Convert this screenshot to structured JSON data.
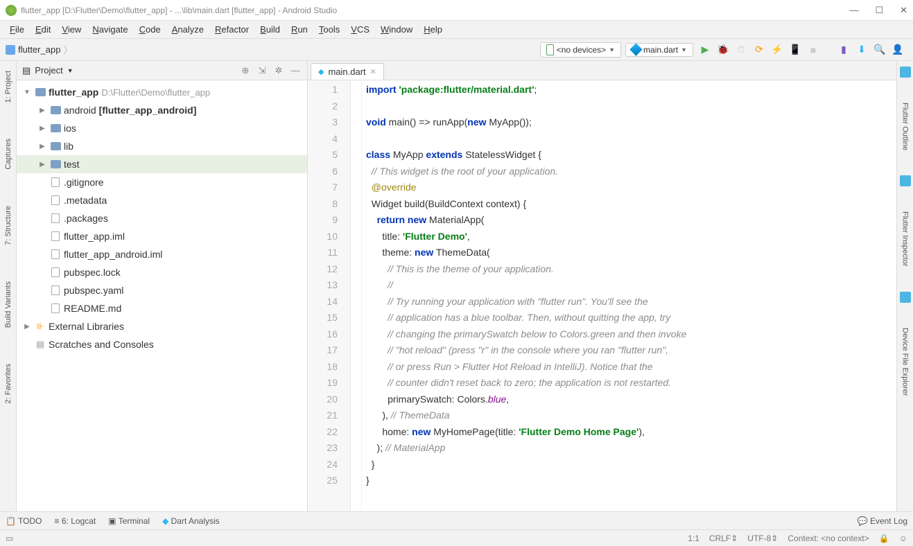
{
  "window": {
    "title": "flutter_app [D:\\Flutter\\Demo\\flutter_app] - ...\\lib\\main.dart [flutter_app] - Android Studio"
  },
  "menu": [
    "File",
    "Edit",
    "View",
    "Navigate",
    "Code",
    "Analyze",
    "Refactor",
    "Build",
    "Run",
    "Tools",
    "VCS",
    "Window",
    "Help"
  ],
  "breadcrumb": {
    "root": "flutter_app"
  },
  "deviceSelector": "<no devices>",
  "runSelector": "main.dart",
  "projectPane": {
    "title": "Project",
    "tree": {
      "root": "flutter_app",
      "rootPath": "D:\\Flutter\\Demo\\flutter_app",
      "items": [
        {
          "label": "android",
          "suffix": "[flutter_app_android]",
          "bold": true,
          "type": "folder",
          "depth": 1,
          "arrow": "▶"
        },
        {
          "label": "ios",
          "type": "folder",
          "depth": 1,
          "arrow": "▶"
        },
        {
          "label": "lib",
          "type": "folder",
          "depth": 1,
          "arrow": "▶"
        },
        {
          "label": "test",
          "type": "folder",
          "depth": 1,
          "arrow": "▶",
          "selected": true
        },
        {
          "label": ".gitignore",
          "type": "file",
          "depth": 1
        },
        {
          "label": ".metadata",
          "type": "file",
          "depth": 1
        },
        {
          "label": ".packages",
          "type": "file",
          "depth": 1
        },
        {
          "label": "flutter_app.iml",
          "type": "file",
          "depth": 1
        },
        {
          "label": "flutter_app_android.iml",
          "type": "file",
          "depth": 1
        },
        {
          "label": "pubspec.lock",
          "type": "file",
          "depth": 1
        },
        {
          "label": "pubspec.yaml",
          "type": "file",
          "depth": 1
        },
        {
          "label": "README.md",
          "type": "file",
          "depth": 1
        }
      ],
      "extLib": "External Libraries",
      "scratches": "Scratches and Consoles"
    }
  },
  "editor": {
    "tab": "main.dart",
    "lines": [
      {
        "n": 1,
        "html": "<span class='kw'>import</span> <span class='str'>'package:flutter/material.dart'</span>;"
      },
      {
        "n": 2,
        "html": ""
      },
      {
        "n": 3,
        "html": "<span class='kw'>void</span> main() => runApp(<span class='kw'>new</span> MyApp());"
      },
      {
        "n": 4,
        "html": ""
      },
      {
        "n": 5,
        "html": "<span class='kw'>class</span> MyApp <span class='kw'>extends</span> StatelessWidget {"
      },
      {
        "n": 6,
        "html": "  <span class='cmt'>// This widget is the root of your application.</span>"
      },
      {
        "n": 7,
        "html": "  <span class='ann'>@override</span>"
      },
      {
        "n": 8,
        "html": "  Widget build(BuildContext context) {"
      },
      {
        "n": 9,
        "html": "    <span class='kw'>return new</span> MaterialApp("
      },
      {
        "n": 10,
        "html": "      title: <span class='str'>'Flutter Demo'</span>,"
      },
      {
        "n": 11,
        "html": "      theme: <span class='kw'>new</span> ThemeData("
      },
      {
        "n": 12,
        "html": "        <span class='cmt'>// This is the theme of your application.</span>"
      },
      {
        "n": 13,
        "html": "        <span class='cmt'>//</span>"
      },
      {
        "n": 14,
        "html": "        <span class='cmt'>// Try running your application with \"flutter run\". You'll see the</span>"
      },
      {
        "n": 15,
        "html": "        <span class='cmt'>// application has a blue toolbar. Then, without quitting the app, try</span>"
      },
      {
        "n": 16,
        "html": "        <span class='cmt'>// changing the primarySwatch below to Colors.green and then invoke</span>"
      },
      {
        "n": 17,
        "html": "        <span class='cmt'>// \"hot reload\" (press \"r\" in the console where you ran \"flutter run\",</span>"
      },
      {
        "n": 18,
        "html": "        <span class='cmt'>// or press Run > Flutter Hot Reload in IntelliJ). Notice that the</span>"
      },
      {
        "n": 19,
        "html": "        <span class='cmt'>// counter didn't reset back to zero; the application is not restarted.</span>"
      },
      {
        "n": 20,
        "html": "        primarySwatch: Colors.<span class='fld'>blue</span>,"
      },
      {
        "n": 21,
        "html": "      ), <span class='cmt'>// ThemeData</span>"
      },
      {
        "n": 22,
        "html": "      home: <span class='kw'>new</span> MyHomePage(title: <span class='str'>'Flutter Demo Home Page'</span>),"
      },
      {
        "n": 23,
        "html": "    ); <span class='cmt'>// MaterialApp</span>"
      },
      {
        "n": 24,
        "html": "  }"
      },
      {
        "n": 25,
        "html": "}"
      }
    ]
  },
  "leftTabs": [
    "1: Project",
    "Captures",
    "7: Structure",
    "Build Variants",
    "2: Favorites"
  ],
  "rightTabs": [
    "Flutter Outline",
    "Flutter Inspector",
    "Device File Explorer"
  ],
  "bottomTabs": {
    "todo": "TODO",
    "logcat": "6: Logcat",
    "terminal": "Terminal",
    "dart": "Dart Analysis",
    "eventlog": "Event Log"
  },
  "status": {
    "pos": "1:1",
    "lineend": "CRLF",
    "enc": "UTF-8",
    "ctx": "Context: <no context>"
  }
}
